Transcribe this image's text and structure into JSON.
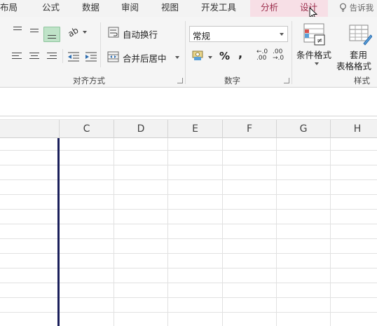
{
  "menu": {
    "tabs": [
      "布局",
      "公式",
      "数据",
      "审阅",
      "视图",
      "开发工具"
    ],
    "contextual_tabs": [
      "分析",
      "设计"
    ],
    "tell_me": "告诉我"
  },
  "ribbon": {
    "alignment": {
      "label": "对齐方式",
      "wrap_text": "自动换行",
      "merge_center": "合并后居中"
    },
    "number": {
      "label": "数字",
      "format": "常规",
      "percent": "%",
      "comma": ",",
      "increase_decimal": "←.0\n.00",
      "decrease_decimal": ".00\n→.0"
    },
    "styles": {
      "label": "样式",
      "conditional_formatting": "条件格式",
      "format_as_table_line1": "套用",
      "format_as_table_line2": "表格格式"
    }
  },
  "grid": {
    "columns": [
      "C",
      "D",
      "E",
      "F",
      "G",
      "H"
    ]
  },
  "colors": {
    "contextual_tab_bg": "#f7dfe6",
    "active_align_bg": "#bfe3c8",
    "freeze_line": "#1a1f5a"
  }
}
